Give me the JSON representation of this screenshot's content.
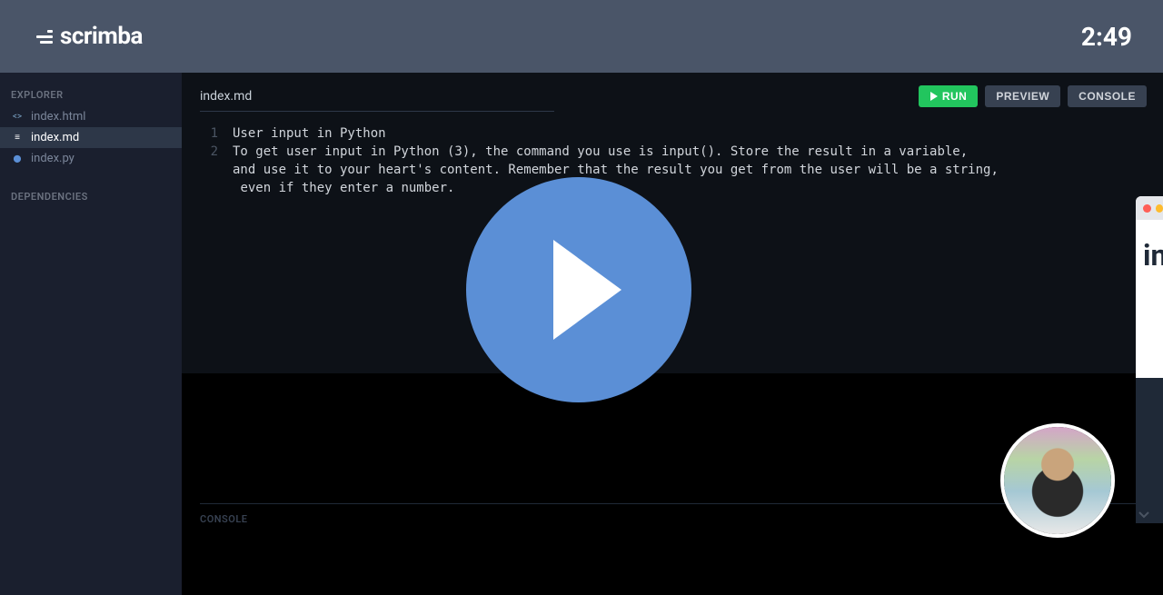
{
  "header": {
    "brand": "scrimba",
    "timer": "2:49"
  },
  "sidebar": {
    "explorer_label": "EXPLORER",
    "dependencies_label": "DEPENDENCIES",
    "files": [
      {
        "name": "index.html",
        "icon": "<>"
      },
      {
        "name": "index.md",
        "icon": "≡"
      },
      {
        "name": "index.py",
        "icon": "⬤"
      }
    ]
  },
  "editor": {
    "active_file": "index.md",
    "buttons": {
      "run": "RUN",
      "preview": "PREVIEW",
      "console": "CONSOLE"
    },
    "lines": {
      "l1_num": "1",
      "l1_text": "User input in Python",
      "l2_num": "2",
      "l2_text": "To get user input in Python (3), the command you use is input(). Store the result in a variable,",
      "l2b_text": "and use it to your heart's content. Remember that the result you get from the user will be a string,",
      "l2c_text": " even if they enter a number."
    }
  },
  "console": {
    "label": "CONSOLE"
  },
  "preview": {
    "heading_fragment": "in"
  }
}
